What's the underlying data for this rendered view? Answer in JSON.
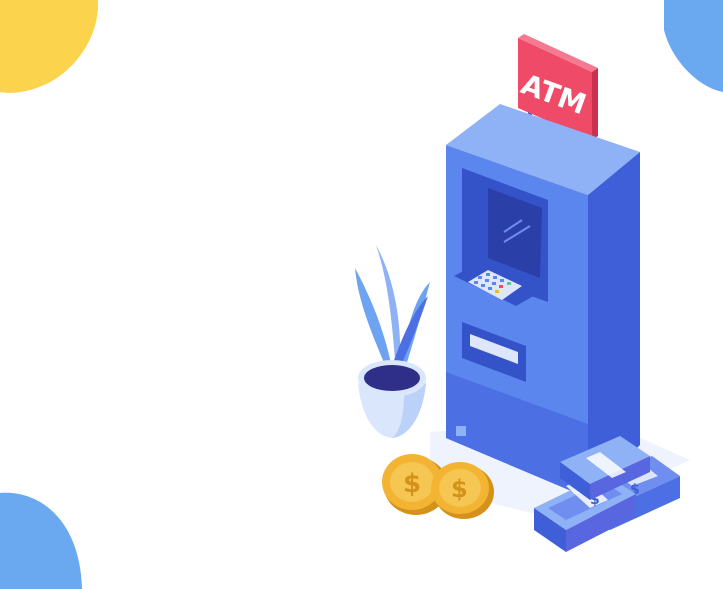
{
  "sign": {
    "label": "ATM"
  },
  "colors": {
    "background": "#ffffff",
    "blob_yellow": "#fcd34d",
    "blob_blue": "#6aa8f0",
    "atm_front": "#5b86ee",
    "atm_side": "#3f5fd8",
    "atm_top": "#8fb2f7",
    "sign_red": "#ef4a68",
    "coin_gold": "#f2b432",
    "cash_blue": "#5866e0",
    "plant_leaf": "#6ea3f2",
    "pot": "#d9e6fb",
    "soil": "#2f2f8a"
  },
  "icons": {
    "coin_symbol": "dollar-icon",
    "banknote_symbol": "dollar-icon"
  }
}
